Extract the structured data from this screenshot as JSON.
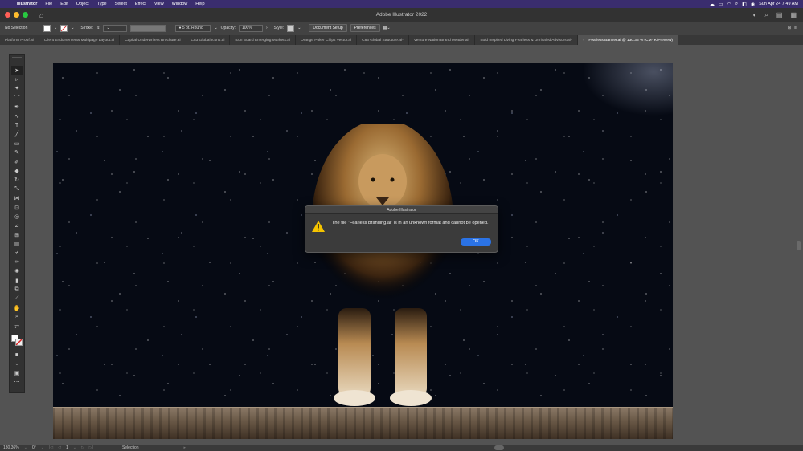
{
  "menubar": {
    "app": "Illustrator",
    "items": [
      "File",
      "Edit",
      "Object",
      "Type",
      "Select",
      "Effect",
      "View",
      "Window",
      "Help"
    ],
    "datetime": "Sun Apr 24 7:49 AM"
  },
  "window": {
    "title": "Adobe Illustrator 2022"
  },
  "control_bar": {
    "selection": "No Selection",
    "stroke_label": "Stroke:",
    "brush": "5 pt. Round",
    "opacity_label": "Opacity:",
    "opacity_value": "100%",
    "style_label": "Style:",
    "document_setup": "Document Setup",
    "preferences": "Preferences"
  },
  "tabs": [
    {
      "label": "Platform Proof.ai",
      "active": false
    },
    {
      "label": "Client Endorsements Multipage Layout.ai",
      "active": false
    },
    {
      "label": "Capital Underwriters Brochure.ai",
      "active": false
    },
    {
      "label": "C83 Global Icons.ai",
      "active": false
    },
    {
      "label": "Icon Board Emerging Markets.ai",
      "active": false
    },
    {
      "label": "Orange Poker Chips Vector.ai",
      "active": false
    },
    {
      "label": "C83 Global Structure.ai*",
      "active": false
    },
    {
      "label": "Venture Nation Brand Header.ai*",
      "active": false
    },
    {
      "label": "Bold Inspired Living Fearless & Unrivaled Advisors.ai*",
      "active": false
    },
    {
      "label": "Fearless Banner.ai @ 130.36 % (CMYK/Preview)",
      "active": true
    }
  ],
  "dialog": {
    "title": "Adobe Illustrator",
    "message": "The file \"Fearless Branding.ai\" is in an unknown format and cannot be opened.",
    "ok": "OK"
  },
  "statusbar": {
    "zoom": "130.36%",
    "rotation": "0°",
    "artboard": "1",
    "tool": "Selection"
  },
  "colors": {
    "menubar": "#3a2d6e",
    "ok_button": "#2b73e6"
  }
}
